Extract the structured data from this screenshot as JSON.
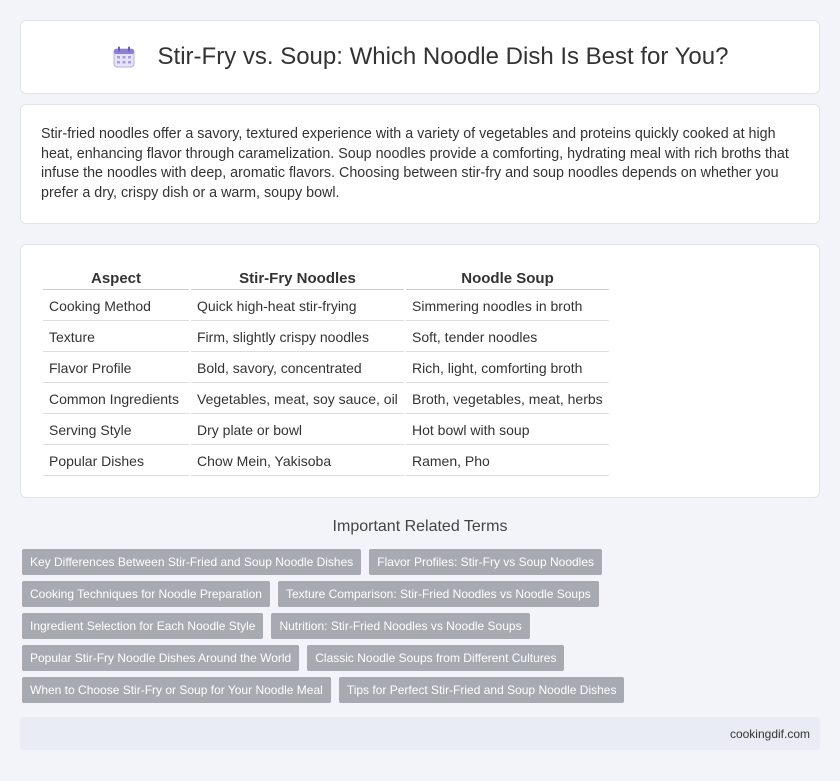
{
  "header": {
    "title": "Stir-Fry vs. Soup: Which Noodle Dish Is Best for You?",
    "icon": "calendar-icon"
  },
  "intro": {
    "text": "Stir-fried noodles offer a savory, textured experience with a variety of vegetables and proteins quickly cooked at high heat, enhancing flavor through caramelization. Soup noodles provide a comforting, hydrating meal with rich broths that infuse the noodles with deep, aromatic flavors. Choosing between stir-fry and soup noodles depends on whether you prefer a dry, crispy dish or a warm, soupy bowl."
  },
  "table": {
    "headers": [
      "Aspect",
      "Stir-Fry Noodles",
      "Noodle Soup"
    ],
    "rows": [
      [
        "Cooking Method",
        "Quick high-heat stir-frying",
        "Simmering noodles in broth"
      ],
      [
        "Texture",
        "Firm, slightly crispy noodles",
        "Soft, tender noodles"
      ],
      [
        "Flavor Profile",
        "Bold, savory, concentrated",
        "Rich, light, comforting broth"
      ],
      [
        "Common Ingredients",
        "Vegetables, meat, soy sauce, oil",
        "Broth, vegetables, meat, herbs"
      ],
      [
        "Serving Style",
        "Dry plate or bowl",
        "Hot bowl with soup"
      ],
      [
        "Popular Dishes",
        "Chow Mein, Yakisoba",
        "Ramen, Pho"
      ]
    ]
  },
  "related": {
    "title": "Important Related Terms",
    "tags": [
      "Key Differences Between Stir-Fried and Soup Noodle Dishes",
      "Flavor Profiles: Stir-Fry vs Soup Noodles",
      "Cooking Techniques for Noodle Preparation",
      "Texture Comparison: Stir-Fried Noodles vs Noodle Soups",
      "Ingredient Selection for Each Noodle Style",
      "Nutrition: Stir-Fried Noodles vs Noodle Soups",
      "Popular Stir-Fry Noodle Dishes Around the World",
      "Classic Noodle Soups from Different Cultures",
      "When to Choose Stir-Fry or Soup for Your Noodle Meal",
      "Tips for Perfect Stir-Fried and Soup Noodle Dishes"
    ]
  },
  "footer": {
    "site": "cookingdif.com"
  },
  "colors": {
    "background": "#f2f4f9",
    "tag_bg": "#a7aab1",
    "footer_bg": "#e9ecf5"
  }
}
